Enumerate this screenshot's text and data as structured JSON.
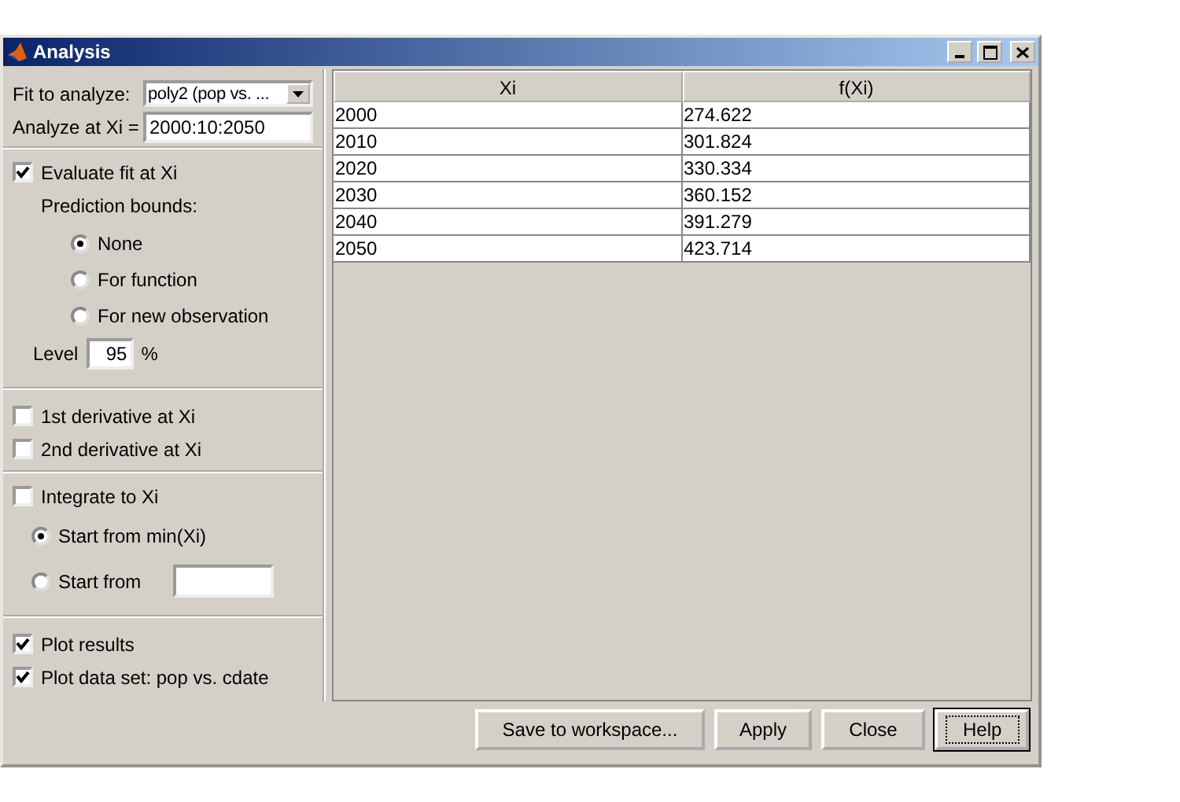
{
  "window": {
    "title": "Analysis"
  },
  "fit": {
    "fit_label": "Fit to analyze:",
    "fit_value": "poly2 (pop vs. ...",
    "xi_label": "Analyze at Xi =",
    "xi_value": "2000:10:2050"
  },
  "evaluate": {
    "label": "Evaluate fit at Xi",
    "checked": true
  },
  "bounds_label": "Prediction bounds:",
  "bounds": [
    {
      "label": "None",
      "selected": true
    },
    {
      "label": "For function",
      "selected": false
    },
    {
      "label": "For new observation",
      "selected": false
    }
  ],
  "level": {
    "label": "Level",
    "value": "95",
    "unit": "%"
  },
  "derivatives": [
    {
      "label": "1st derivative at Xi",
      "checked": false
    },
    {
      "label": "2nd derivative at Xi",
      "checked": false
    }
  ],
  "integrate": {
    "label": "Integrate to Xi",
    "checked": false
  },
  "start": [
    {
      "kind": "plain",
      "label": "Start from min(Xi)",
      "selected": true
    },
    {
      "kind": "field",
      "label": "Start from",
      "selected": false
    }
  ],
  "plots": [
    {
      "label": "Plot results",
      "checked": true
    },
    {
      "label": "Plot data set: pop vs. cdate",
      "checked": true
    }
  ],
  "table": {
    "columns": [
      "Xi",
      "f(Xi)"
    ],
    "rows": [
      [
        "2000",
        "274.622"
      ],
      [
        "2010",
        "301.824"
      ],
      [
        "2020",
        "330.334"
      ],
      [
        "2030",
        "360.152"
      ],
      [
        "2040",
        "391.279"
      ],
      [
        "2050",
        "423.714"
      ]
    ]
  },
  "buttons": [
    {
      "label": "Save to workspace...",
      "focused": false
    },
    {
      "label": "Apply",
      "focused": false
    },
    {
      "label": "Close",
      "focused": false
    },
    {
      "label": "Help",
      "focused": true
    }
  ]
}
